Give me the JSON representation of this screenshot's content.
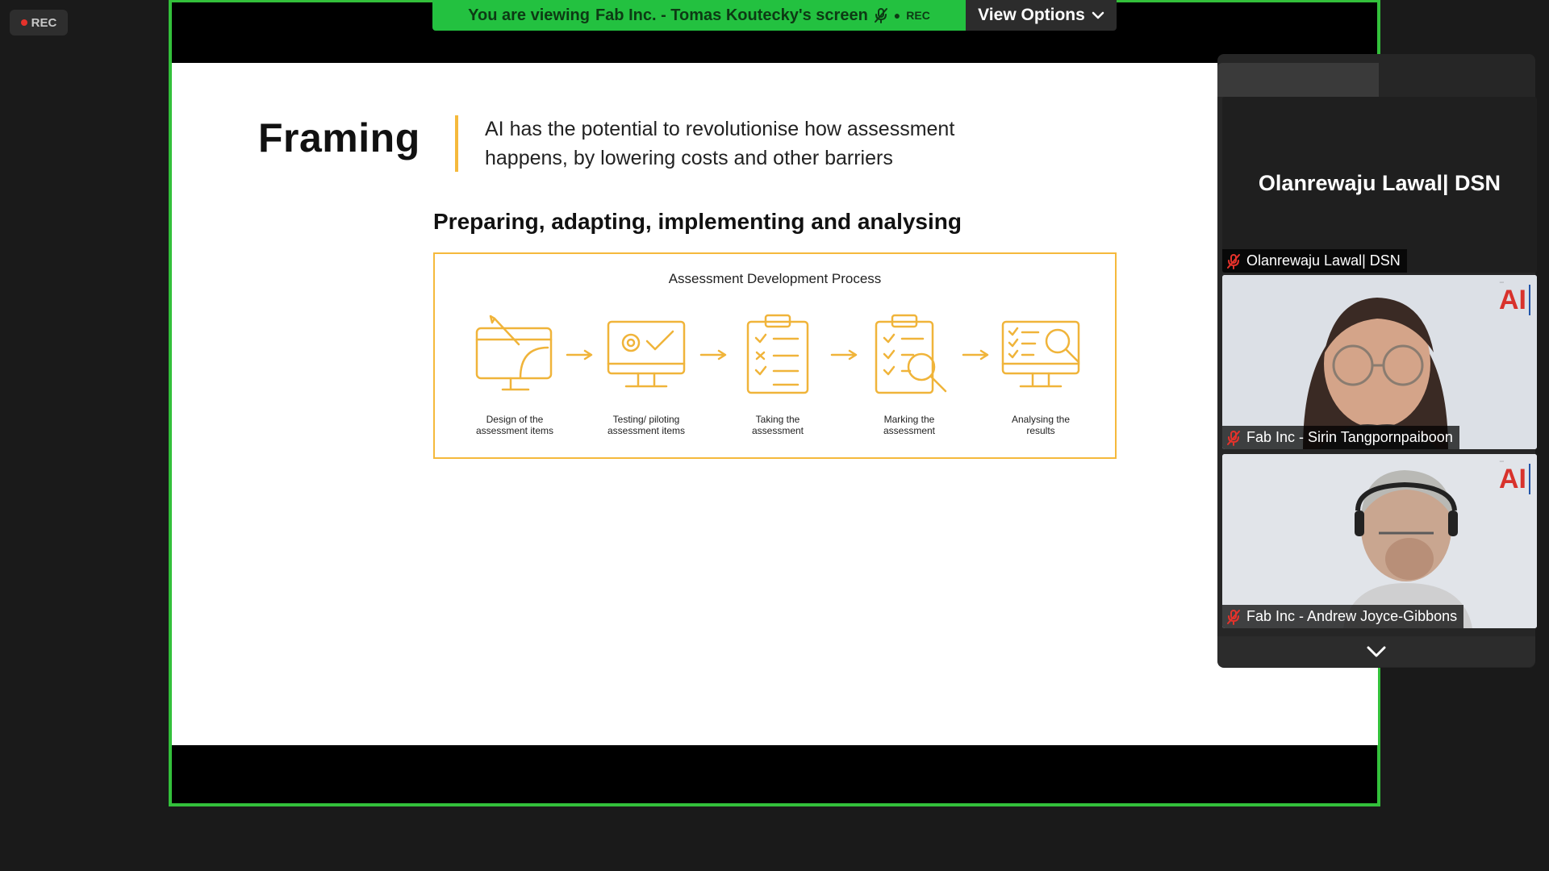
{
  "app": {
    "rec_label": "REC"
  },
  "viewbar": {
    "prefix": "You are viewing",
    "presenter": "Fab Inc. - Tomas Koutecky's screen",
    "rec_label": "REC",
    "view_options_label": "View Options"
  },
  "slide": {
    "title": "Framing",
    "description": "AI has the potential to revolutionise how assessment happens, by lowering costs and other barriers",
    "subtitle": "Preparing, adapting, implementing and analysing",
    "process_title": "Assessment Development Process",
    "steps": [
      {
        "label_line1": "Design of the",
        "label_line2": "assessment items",
        "icon": "drafting-icon"
      },
      {
        "label_line1": "Testing/ piloting",
        "label_line2": "assessment items",
        "icon": "monitor-gear-check-icon"
      },
      {
        "label_line1": "Taking the",
        "label_line2": "assessment",
        "icon": "clipboard-checklist-icon"
      },
      {
        "label_line1": "Marking the",
        "label_line2": "assessment",
        "icon": "clipboard-magnifier-icon"
      },
      {
        "label_line1": "Analysing the",
        "label_line2": "results",
        "icon": "monitor-analysis-icon"
      }
    ]
  },
  "participants": [
    {
      "name": "Olanrewaju Lawal| DSN",
      "display_name": "Olanrewaju Lawal| DSN",
      "video": false,
      "muted": true
    },
    {
      "name": "Fab Inc - Sirin Tangpornpaiboon",
      "video": true,
      "muted": true,
      "logo": "AI"
    },
    {
      "name": "Fab Inc - Andrew Joyce-Gibbons",
      "video": true,
      "muted": true,
      "logo": "AI"
    }
  ],
  "colors": {
    "accent_green": "#23c140",
    "slide_accent": "#f5b93c",
    "muted_red": "#e5322b"
  }
}
